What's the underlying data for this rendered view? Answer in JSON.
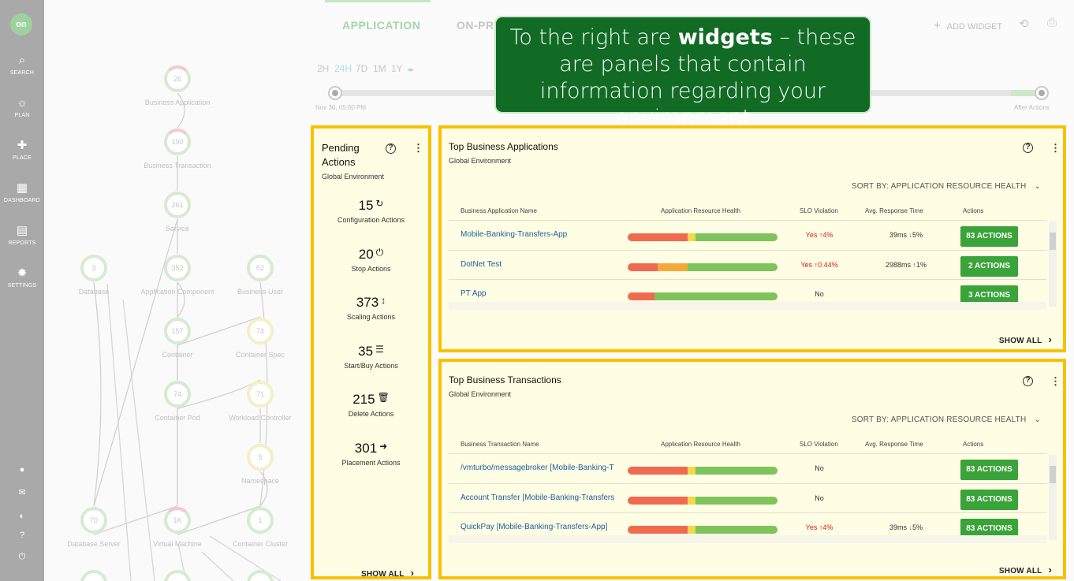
{
  "sidebar": {
    "logo": "on",
    "items": [
      {
        "label": "SEARCH",
        "icon": "search-icon"
      },
      {
        "label": "PLAN",
        "icon": "lightbulb-icon"
      },
      {
        "label": "PLACE",
        "icon": "puzzle-icon"
      },
      {
        "label": "DASHBOARD",
        "icon": "dashboard-icon"
      },
      {
        "label": "REPORTS",
        "icon": "clipboard-icon"
      },
      {
        "label": "SETTINGS",
        "icon": "gear-icon"
      }
    ],
    "bottom_icons": [
      "info-icon",
      "mail-icon",
      "circle-icon",
      "help-icon",
      "power-icon"
    ]
  },
  "topology": {
    "nodes": [
      {
        "id": "business-application",
        "count": "26",
        "label": "Business Application"
      },
      {
        "id": "business-transaction",
        "count": "190",
        "label": "Business Transaction"
      },
      {
        "id": "service",
        "count": "261",
        "label": "Service"
      },
      {
        "id": "database",
        "count": "3",
        "label": "Database"
      },
      {
        "id": "application-component",
        "count": "352",
        "label": "Application Component"
      },
      {
        "id": "business-user",
        "count": "52",
        "label": "Business User"
      },
      {
        "id": "container",
        "count": "157",
        "label": "Container"
      },
      {
        "id": "container-spec",
        "count": "74",
        "label": "Container Spec"
      },
      {
        "id": "container-pod",
        "count": "74",
        "label": "Container Pod"
      },
      {
        "id": "workload-controller",
        "count": "71",
        "label": "Workload Controller"
      },
      {
        "id": "namespace",
        "count": "5",
        "label": "Namespace"
      },
      {
        "id": "database-server",
        "count": "70",
        "label": "Database Server"
      },
      {
        "id": "virtual-machine",
        "count": "1K",
        "label": "Virtual Machine"
      },
      {
        "id": "container-cluster",
        "count": "1",
        "label": "Container Cluster"
      }
    ]
  },
  "header": {
    "tabs": [
      "APPLICATION",
      "ON-PREM"
    ],
    "add_widget": "ADD WIDGET",
    "plus": "+"
  },
  "timeline": {
    "ranges": [
      "2H",
      "24H",
      "7D",
      "1M",
      "1Y"
    ],
    "selected": "24H",
    "start_label": "Nov 30, 05:00 PM",
    "end_label": "After Actions"
  },
  "callout": {
    "pre": "To the right are ",
    "bold": "widgets",
    "post": " – these are panels that contain information regarding your environment"
  },
  "pending_actions": {
    "title": "Pending Actions",
    "subtitle": "Global Environment",
    "items": [
      {
        "count": "15",
        "glyph": "↻",
        "label": "Configuration Actions"
      },
      {
        "count": "20",
        "glyph": "⏻",
        "label": "Stop Actions"
      },
      {
        "count": "373",
        "glyph": "↕",
        "label": "Scaling Actions"
      },
      {
        "count": "35",
        "glyph": "☰",
        "label": "Start/Buy Actions"
      },
      {
        "count": "215",
        "glyph": "🗑",
        "label": "Delete Actions"
      },
      {
        "count": "301",
        "glyph": "➜",
        "label": "Placement Actions"
      }
    ],
    "show_all": "SHOW ALL"
  },
  "widgets": [
    {
      "title": "Top Business Applications",
      "subtitle": "Global Environment",
      "sort_by": "SORT BY: APPLICATION RESOURCE HEALTH",
      "columns": [
        "Business Application Name",
        "Application Resource Health",
        "SLO Violation",
        "Avg. Response Time",
        "Actions"
      ],
      "rows": [
        {
          "name": "Mobile-Banking-Transfers-App",
          "health": [
            40,
            5,
            55
          ],
          "slo": "Yes",
          "slo_trend": "4%",
          "rt": "39ms",
          "rt_trend": "5%",
          "action": "83 ACTIONS"
        },
        {
          "name": "DotNet Test",
          "health": [
            20,
            20,
            60
          ],
          "slo": "Yes",
          "slo_trend": "0.44%",
          "rt": "2988ms",
          "rt_trend": "1%",
          "action": "2 ACTIONS"
        },
        {
          "name": "PT App",
          "health": [
            18,
            0,
            82
          ],
          "slo": "No",
          "slo_trend": "",
          "rt": "",
          "rt_trend": "",
          "action": "3 ACTIONS"
        }
      ],
      "show_all": "SHOW ALL"
    },
    {
      "title": "Top Business Transactions",
      "subtitle": "Global Environment",
      "sort_by": "SORT BY: APPLICATION RESOURCE HEALTH",
      "columns": [
        "Business Transaction Name",
        "Application Resource Health",
        "SLO Violation",
        "Avg. Response Time",
        "Actions"
      ],
      "rows": [
        {
          "name": "/vmturbo/messagebroker [Mobile-Banking-T",
          "health": [
            40,
            5,
            55
          ],
          "slo": "No",
          "slo_trend": "",
          "rt": "",
          "rt_trend": "",
          "action": "83 ACTIONS"
        },
        {
          "name": "Account Transfer [Mobile-Banking-Transfers",
          "health": [
            40,
            5,
            55
          ],
          "slo": "No",
          "slo_trend": "",
          "rt": "",
          "rt_trend": "",
          "action": "83 ACTIONS"
        },
        {
          "name": "QuickPay [Mobile-Banking-Transfers-App]",
          "health": [
            40,
            5,
            55
          ],
          "slo": "Yes",
          "slo_trend": "4%",
          "rt": "39ms",
          "rt_trend": "5%",
          "action": "83 ACTIONS"
        }
      ],
      "show_all": "SHOW ALL"
    }
  ],
  "colors": {
    "red": "#f06a4f",
    "orange": "#f5a93a",
    "yellow": "#f3d84a",
    "green": "#7ec35b",
    "highlight": "#f8c100"
  }
}
